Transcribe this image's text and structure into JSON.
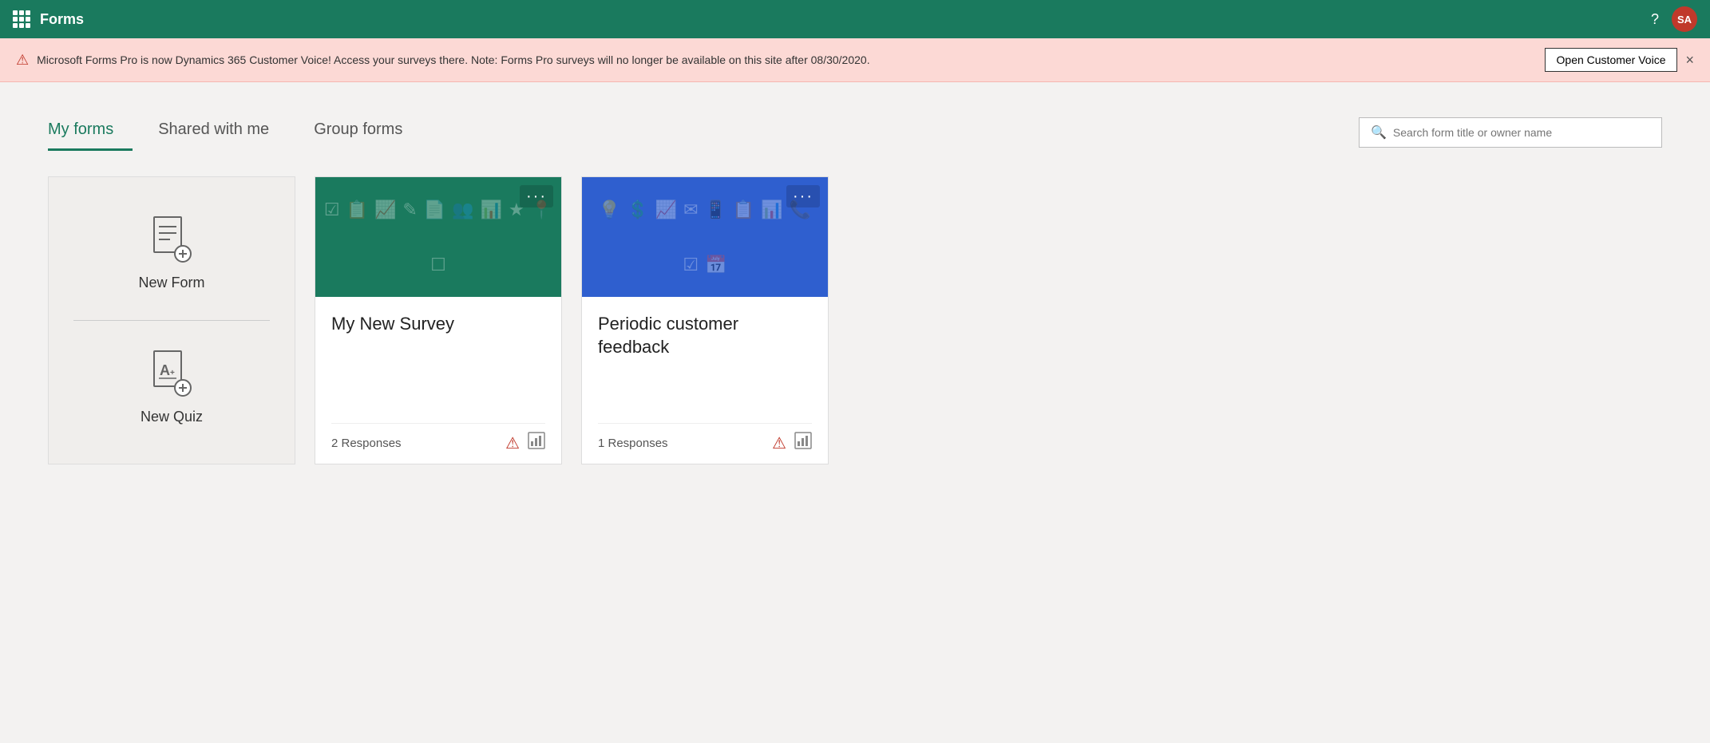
{
  "app": {
    "title": "Forms",
    "avatar_initials": "SA",
    "help_label": "?"
  },
  "banner": {
    "text": "Microsoft Forms Pro is now Dynamics 365 Customer Voice! Access your surveys there. Note: Forms Pro surveys will no longer be available on this site after 08/30/2020.",
    "open_button_label": "Open Customer Voice",
    "close_label": "×"
  },
  "tabs": [
    {
      "label": "My forms",
      "active": true
    },
    {
      "label": "Shared with me",
      "active": false
    },
    {
      "label": "Group forms",
      "active": false
    }
  ],
  "search": {
    "placeholder": "Search form title or owner name"
  },
  "new_cards": [
    {
      "id": "new-form",
      "top_label": "New Form",
      "bottom_label": "New Quiz"
    }
  ],
  "survey_cards": [
    {
      "id": "survey-1",
      "title": "My New Survey",
      "color": "teal",
      "responses": "2 Responses",
      "menu": "···"
    },
    {
      "id": "survey-2",
      "title": "Periodic customer feedback",
      "color": "blue",
      "responses": "1 Responses",
      "menu": "···"
    }
  ],
  "colors": {
    "teal": "#1a7a5e",
    "blue": "#2f5fcf",
    "active_tab": "#1a7a5e",
    "warning": "#c0392b"
  }
}
